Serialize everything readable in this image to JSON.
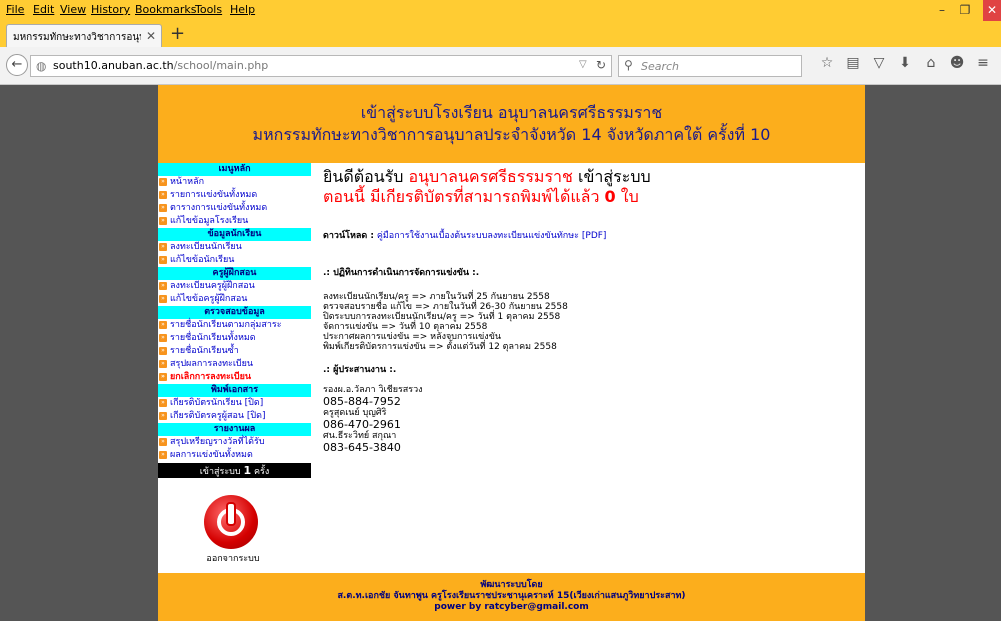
{
  "browser": {
    "menu": [
      "File",
      "Edit",
      "View",
      "History",
      "Bookmarks",
      "Tools",
      "Help"
    ],
    "tab_title": "มหกรรมทักษะทางวิชาการอนุบา...",
    "url_domain": "south10.anuban.ac.th",
    "url_path": "/school/main.php",
    "search_placeholder": "Search"
  },
  "header": {
    "line1": "เข้าสู่ระบบโรงเรียน อนุบาลนครศรีธรรมราช",
    "line2": "มหกรรมทักษะทางวิชาการอนุบาลประจำจังหวัด 14 จังหวัดภาคใต้ ครั้งที่ 10"
  },
  "sidebar": {
    "sections": [
      {
        "title": "เมนูหลัก",
        "items": [
          "หน้าหลัก",
          "รายการแข่งขันทั้งหมด",
          "ตารางการแข่งขันทั้งหมด",
          "แก้ไขข้อมูลโรงเรียน"
        ]
      },
      {
        "title": "ข้อมูลนักเรียน",
        "items": [
          "ลงทะเบียนนักเรียน",
          "แก้ไขข้อนักเรียน"
        ]
      },
      {
        "title": "ครูผู้ฝึกสอน",
        "items": [
          "ลงทะเบียนครูผู้ฝึกสอน",
          "แก้ไขข้อครูผู้ฝึกสอน"
        ]
      },
      {
        "title": "ตรวจสอบข้อมูล",
        "items": [
          "รายชื่อนักเรียนตามกลุ่มสาระ",
          "รายชื่อนักเรียนทั้งหมด",
          "รายชื่อนักเรียนซ้ำ",
          "สรุปผลการลงทะเบียน",
          "ยกเลิกการลงทะเบียน"
        ]
      },
      {
        "title": "พิมพ์เอกสาร",
        "items": [
          "เกียรติบัตรนักเรียน [ปิด]",
          "เกียรติบัตรครูผู้สอน [ปิด]"
        ]
      },
      {
        "title": "รายงานผล",
        "items": [
          "สรุปเหรียญรางวัลที่ได้รับ",
          "ผลการแข่งขันทั้งหมด"
        ]
      }
    ],
    "visit_prefix": "เข้าสู่ระบบ",
    "visit_count": "1",
    "visit_suffix": "ครั้ง",
    "logout_label": "ออกจากระบบ"
  },
  "main": {
    "welcome_prefix": "ยินดีต้อนรับ",
    "school_name": "อนุบาลนครศรีธรรมราช",
    "welcome_suffix": "เข้าสู่ระบบ",
    "cert_text": "ตอนนี้ มีเกียรติบัตรที่สามารถพิมพ์ได้แล้ว",
    "cert_count": "0",
    "cert_unit": "ใบ",
    "download_label": "ดาวน์โหลด :",
    "download_link": "คู่มือการใช้งานเบื้องต้นระบบลงทะเบียนแข่งขันทักษะ [PDF]",
    "schedule_title": ".: ปฏิทินการดำเนินการจัดการแข่งขัน :.",
    "schedule": [
      "ลงทะเบียนนักเรียน/ครู => ภายในวันที่ 25 กันยายน 2558",
      "ตรวจสอบรายชื่อ แก้ไข => ภายในวันที่ 26-30 กันยายน 2558",
      "ปิดระบบการลงทะเบียนนักเรียน/ครู => วันที่ 1 ตุลาคม 2558",
      "จัดการแข่งขัน => วันที่ 10 ตุลาคม 2558",
      "ประกาศผลการแข่งขัน => หลังจบการแข่งขัน",
      "พิมพ์เกียรติบัตรการแข่งขัน => ตั้งแต่วันที่ 12 ตุลาคม 2558"
    ],
    "coord_title": ".: ผู้ประสานงาน :.",
    "contacts": [
      {
        "name": "รองผ.อ.วัลภา วิเชียรสรวง",
        "phone": "085-884-7952"
      },
      {
        "name": "ครูสุดเนย์ บุญศิริ",
        "phone": "086-470-2961"
      },
      {
        "name": "ศน.ธีระวิทย์ สกุณา",
        "phone": "083-645-3840"
      }
    ]
  },
  "footer": {
    "line1": "พัฒนาระบบโดย",
    "line2": "ส.ต.ท.เอกชัย จันทาพูน ครูโรงเรียนราชประชานุเคราะห์ 15(เวียงเก่าแสนภูวิทยาประสาท)",
    "line3": "power by ratcyber@gmail.com"
  }
}
